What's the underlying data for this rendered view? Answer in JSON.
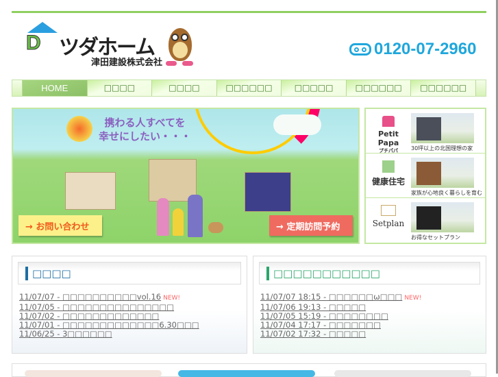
{
  "header": {
    "logo_mark": "D",
    "logo_name": "ツダホーム",
    "logo_sub": "津田建設株式会社",
    "phone": "0120-07-2960",
    "phone_icon": "free-dial-icon"
  },
  "nav": [
    {
      "label": "HOME"
    },
    {
      "label": "□□□□"
    },
    {
      "label": "□□□□"
    },
    {
      "label": "□□□□□□"
    },
    {
      "label": "□□□□□"
    },
    {
      "label": "□□□□□□"
    },
    {
      "label": "□□□□□□"
    }
  ],
  "banner": {
    "tagline1": "携わる人すべてを",
    "tagline2": "幸せにしたい・・・",
    "contact": "→ お問い合わせ",
    "visit": "→ 定期訪問予約"
  },
  "side": [
    {
      "logo": "Petit Papa",
      "logo_sub": "プチパパ",
      "caption": "30坪以上の北国理想の家"
    },
    {
      "logo": "健康住宅",
      "caption": "家族が心地良く暮らしを育む"
    },
    {
      "logo": "Setplan",
      "caption": "お得なセットプラン"
    }
  ],
  "news": {
    "title": "□□□□",
    "color": "#1d6fa3",
    "items": [
      {
        "text": "11/07/07 - □□□□□□□□□□vol.16",
        "new": "NEW!"
      },
      {
        "text": "11/07/05 - □□□□□□□□□□□□□□□"
      },
      {
        "text": "11/07/02 - □□□□□□□□□□□□□"
      },
      {
        "text": "11/07/01 - □□□□□□□□□□□□□6.30□□□"
      },
      {
        "text": "11/06/25 - 3□□□□□□"
      }
    ]
  },
  "blog": {
    "title": "□□□□□□□□□□□",
    "color": "#2aa66a",
    "items": [
      {
        "text": "11/07/07 18:15 - □□□□□□ω□□□",
        "new": "NEW!"
      },
      {
        "text": "11/07/06 19:13 - □□□□□"
      },
      {
        "text": "11/07/05 15:19 - □□□□□□□□"
      },
      {
        "text": "11/07/04 17:17 - □□□□□□□"
      },
      {
        "text": "11/07/02 17:32 - □□□□□"
      }
    ]
  }
}
